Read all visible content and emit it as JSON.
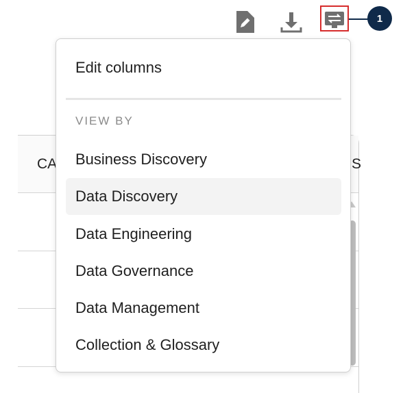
{
  "toolbar": {
    "edit_icon": "edit-document-icon",
    "download_icon": "download-icon",
    "view_switch_icon": "view-switch-icon",
    "icon_color": "#6f6f6f"
  },
  "callout": {
    "number": "1",
    "color": "#0f2a4a",
    "highlight_color": "#d62b2b"
  },
  "table": {
    "header_left": "CA",
    "header_right": "SS"
  },
  "menu": {
    "edit_columns": "Edit columns",
    "section_label": "VIEW BY",
    "items": [
      {
        "label": "Business Discovery",
        "selected": false
      },
      {
        "label": "Data Discovery",
        "selected": true
      },
      {
        "label": "Data Engineering",
        "selected": false
      },
      {
        "label": "Data Governance",
        "selected": false
      },
      {
        "label": "Data Management",
        "selected": false
      },
      {
        "label": "Collection & Glossary",
        "selected": false
      }
    ]
  }
}
